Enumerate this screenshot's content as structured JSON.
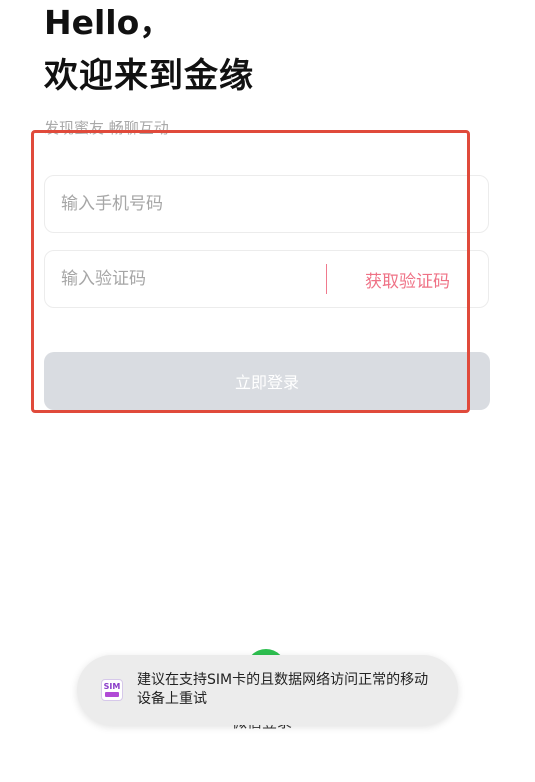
{
  "header": {
    "greeting": "Hello，",
    "welcome": "欢迎来到金缘",
    "subtitle": "发现蜜友 畅聊互动"
  },
  "form": {
    "phone_placeholder": "输入手机号码",
    "code_placeholder": "输入验证码",
    "get_code_label": "获取验证码",
    "login_label": "立即登录"
  },
  "wechat": {
    "label": "微信登录"
  },
  "toast": {
    "icon_text": "SIM",
    "message": "建议在支持SIM卡的且数据网络访问正常的移动设备上重试"
  },
  "colors": {
    "highlight_border": "#e04a3b",
    "accent": "#ef7286",
    "login_disabled_bg": "#d9dce1",
    "wechat_green": "#2dbf4f"
  }
}
